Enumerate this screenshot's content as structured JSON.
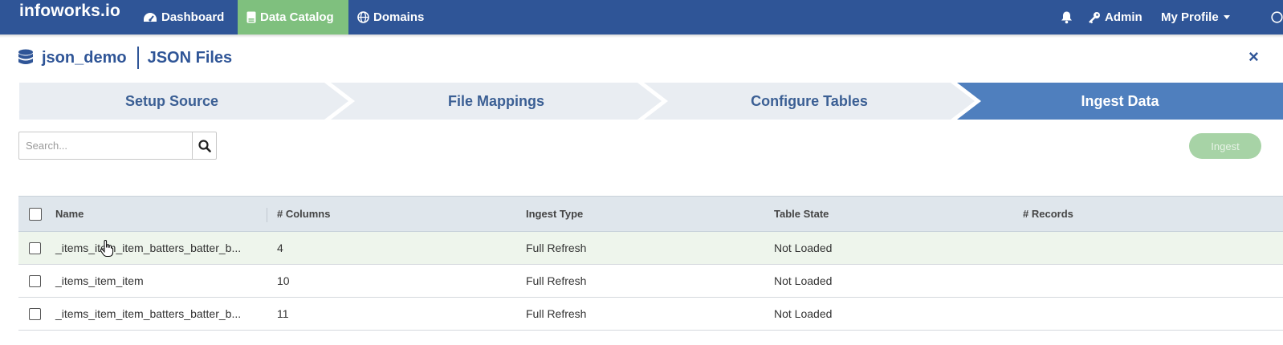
{
  "nav": {
    "brand": "infoworks.io",
    "items": [
      {
        "label": "Dashboard",
        "icon": "dashboard-icon"
      },
      {
        "label": "Data Catalog",
        "icon": "catalog-icon",
        "active": true
      },
      {
        "label": "Domains",
        "icon": "globe-icon"
      }
    ],
    "right": {
      "bell_icon": "bell-icon",
      "admin_label": "Admin",
      "admin_icon": "key-icon",
      "profile_label": "My Profile"
    }
  },
  "header": {
    "source_name": "json_demo",
    "source_type": "JSON Files",
    "close_label": "×"
  },
  "steps": [
    {
      "label": "Setup Source"
    },
    {
      "label": "File Mappings"
    },
    {
      "label": "Configure Tables"
    },
    {
      "label": "Ingest Data",
      "active": true
    }
  ],
  "search": {
    "placeholder": "Search..."
  },
  "ingest_button": {
    "label": "Ingest"
  },
  "table": {
    "columns": [
      "Name",
      "# Columns",
      "Ingest Type",
      "Table State",
      "# Records"
    ],
    "rows": [
      {
        "name": "_items_item_item_batters_batter_b...",
        "columns": "4",
        "ingest_type": "Full Refresh",
        "table_state": "Not Loaded",
        "records": ""
      },
      {
        "name": "_items_item_item",
        "columns": "10",
        "ingest_type": "Full Refresh",
        "table_state": "Not Loaded",
        "records": ""
      },
      {
        "name": "_items_item_item_batters_batter_b...",
        "columns": "11",
        "ingest_type": "Full Refresh",
        "table_state": "Not Loaded",
        "records": ""
      }
    ]
  },
  "colors": {
    "nav_bg": "#2f5597",
    "active_nav": "#7fc07e",
    "active_step": "#4f7fbe",
    "ingest_disabled": "#a7d3a6"
  }
}
